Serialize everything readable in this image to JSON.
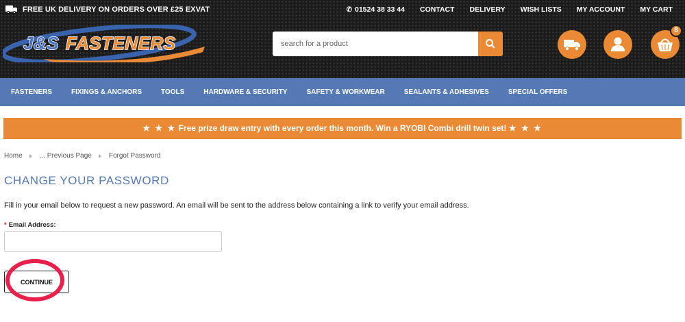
{
  "header": {
    "promo_text": "FREE UK DELIVERY ON ORDERS OVER £25 EXVAT",
    "truck_icon_label": "FREE",
    "phone": "01524 38 33 44",
    "links": [
      "CONTACT",
      "DELIVERY",
      "WISH LISTS",
      "MY ACCOUNT",
      "MY CART"
    ],
    "logo_text": "J&S FASTENERS",
    "cart_count": "8",
    "search": {
      "placeholder": "search for a product"
    },
    "icons": [
      "search-icon",
      "delivery-truck-icon",
      "user-icon",
      "basket-icon",
      "phone-icon"
    ]
  },
  "nav": {
    "items": [
      "FASTENERS",
      "FIXINGS & ANCHORS",
      "TOOLS",
      "HARDWARE & SECURITY",
      "SAFETY & WORKWEAR",
      "SEALANTS & ADHESIVES",
      "SPECIAL OFFERS"
    ]
  },
  "banner": {
    "stars": "★ ★ ★",
    "text": "Free prize draw entry with every order this month. Win a RYOBI Combi drill twin set!"
  },
  "breadcrumb": [
    "Home",
    "... Previous Page",
    "Forgot Password"
  ],
  "main": {
    "title": "CHANGE YOUR PASSWORD",
    "intro": "Fill in your email below to request a new password. An email will be sent to the address below containing a link to verify your email address.",
    "email_label": "Email Address:",
    "required_mark": "*",
    "email_value": "",
    "continue_label": "CONTINUE"
  },
  "colors": {
    "accent_orange": "#ea8a34",
    "nav_blue": "#5479b4",
    "header_dark": "#1b1b1b",
    "highlight_red": "#e8204c"
  }
}
